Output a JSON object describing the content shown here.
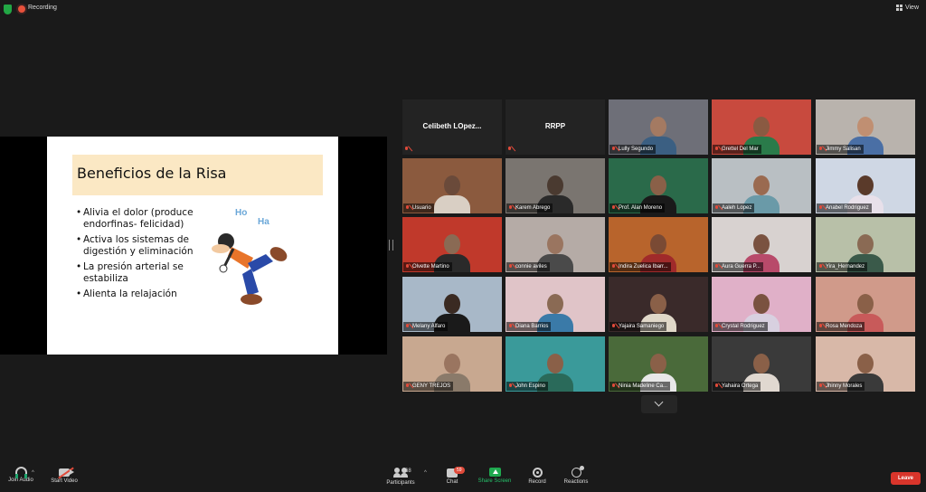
{
  "topbar": {
    "recording_label": "Recording",
    "view_label": "View"
  },
  "slide": {
    "title": "Beneficios de la Risa",
    "bullets": [
      "Alivia el dolor (produce endorfinas- felicidad)",
      "Activa los sistemas de digestión y eliminación",
      "La presión arterial se estabiliza",
      "Alienta la relajación"
    ],
    "laugh_1": "Ho",
    "laugh_2": "Ha"
  },
  "tiles": [
    {
      "name": "Celibeth LOpez...",
      "label": "",
      "show_label": false,
      "bg": "#232323",
      "skin": "",
      "shirt": ""
    },
    {
      "name": "RRPP",
      "label": "",
      "show_label": false,
      "bg": "#232323",
      "skin": "",
      "shirt": ""
    },
    {
      "name": "",
      "label": "Lully Segundo",
      "bg": "#6e6f78",
      "skin": "#a47a62",
      "shirt": "#3b5f82"
    },
    {
      "name": "",
      "label": "Grettel Del Mar",
      "bg": "#c84a3e",
      "skin": "#8a5a42",
      "shirt": "#2a7b4a"
    },
    {
      "name": "",
      "label": "Jimmy Salisan",
      "bg": "#b9b3ad",
      "skin": "#c08f72",
      "shirt": "#4a6fa5"
    },
    {
      "name": "",
      "label": "Usuario",
      "bg": "#8b5a3e",
      "skin": "#6a4a3a",
      "shirt": "#d9cfc4"
    },
    {
      "name": "",
      "label": "Karem Abrego",
      "bg": "#7a7570",
      "skin": "#4a3a30",
      "shirt": "#2a2a2a"
    },
    {
      "name": "",
      "label": "Prof. Alan Moreno",
      "bg": "#2a6a4a",
      "skin": "#8a6048",
      "shirt": "#1a1a1a"
    },
    {
      "name": "",
      "label": "Aaleh Lopez",
      "bg": "#b9bfc3",
      "skin": "#9a6a50",
      "shirt": "#6a9aa8"
    },
    {
      "name": "",
      "label": "Anabel Rodriguez",
      "bg": "#cfd7e4",
      "skin": "#5a3a2a",
      "shirt": "#e8e0ea"
    },
    {
      "name": "",
      "label": "Olvette Martino",
      "bg": "#c0392b",
      "skin": "#8a6a54",
      "shirt": "#2a2a2a"
    },
    {
      "name": "",
      "label": "connie aviles",
      "bg": "#b5aba6",
      "skin": "#9a7560",
      "shirt": "#4a4a4a"
    },
    {
      "name": "",
      "label": "Indira Zuelica Ibarr...",
      "bg": "#b8642c",
      "skin": "#7a4a34",
      "shirt": "#a02a2a"
    },
    {
      "name": "",
      "label": "Aura Guerra P...",
      "bg": "#d8d2d0",
      "skin": "#7a5240",
      "shirt": "#b84a6a"
    },
    {
      "name": "",
      "label": "Yira_Hernandez",
      "bg": "#b8c0a8",
      "skin": "#8a6a54",
      "shirt": "#3a5a4a"
    },
    {
      "name": "",
      "label": "Melany Alfaro",
      "bg": "#a8b8c8",
      "skin": "#3a2a22",
      "shirt": "#1a1a1a"
    },
    {
      "name": "",
      "label": "Diana Barrios",
      "bg": "#e0c4c8",
      "skin": "#8a6a54",
      "shirt": "#3a7aa8"
    },
    {
      "name": "",
      "label": "Yajaira Samaniego",
      "bg": "#3a2a2a",
      "skin": "#8a6048",
      "shirt": "#e0d8c8"
    },
    {
      "name": "",
      "label": "Crystal Rodriguez",
      "bg": "#e0b0c8",
      "skin": "#7a5240",
      "shirt": "#d8d0e0"
    },
    {
      "name": "",
      "label": "Rosa Mendoza",
      "bg": "#d09a8a",
      "skin": "#8a6048",
      "shirt": "#c85a5a"
    },
    {
      "name": "",
      "label": "GENY TREJOS",
      "bg": "#c8a890",
      "skin": "#9a7560",
      "shirt": "#8a7a6a"
    },
    {
      "name": "",
      "label": "John Espino",
      "bg": "#3a9a9a",
      "skin": "#8a6048",
      "shirt": "#2a6a5a"
    },
    {
      "name": "",
      "label": "Ninia Madeline Ca...",
      "bg": "#4a6a3a",
      "skin": "#8a6048",
      "shirt": "#e8e8e8"
    },
    {
      "name": "",
      "label": "Yahaira Ortega",
      "bg": "#3a3a3a",
      "skin": "#8a6048",
      "shirt": "#e0d8d0"
    },
    {
      "name": "",
      "label": "Jhinny Morales",
      "bg": "#d8b8a8",
      "skin": "#8a6048",
      "shirt": "#3a3a3a"
    }
  ],
  "toolbar": {
    "join_audio": "Join Audio",
    "start_video": "Start Video",
    "participants": "Participants",
    "participants_count": "68",
    "chat": "Chat",
    "chat_badge": "59",
    "share_screen": "Share Screen",
    "record": "Record",
    "reactions": "Reactions",
    "leave": "Leave"
  },
  "colors": {
    "background": "#1a1a1a",
    "accent_green": "#1fa94f",
    "leave_red": "#d9352b",
    "active_speaker": "#d9e65a"
  }
}
